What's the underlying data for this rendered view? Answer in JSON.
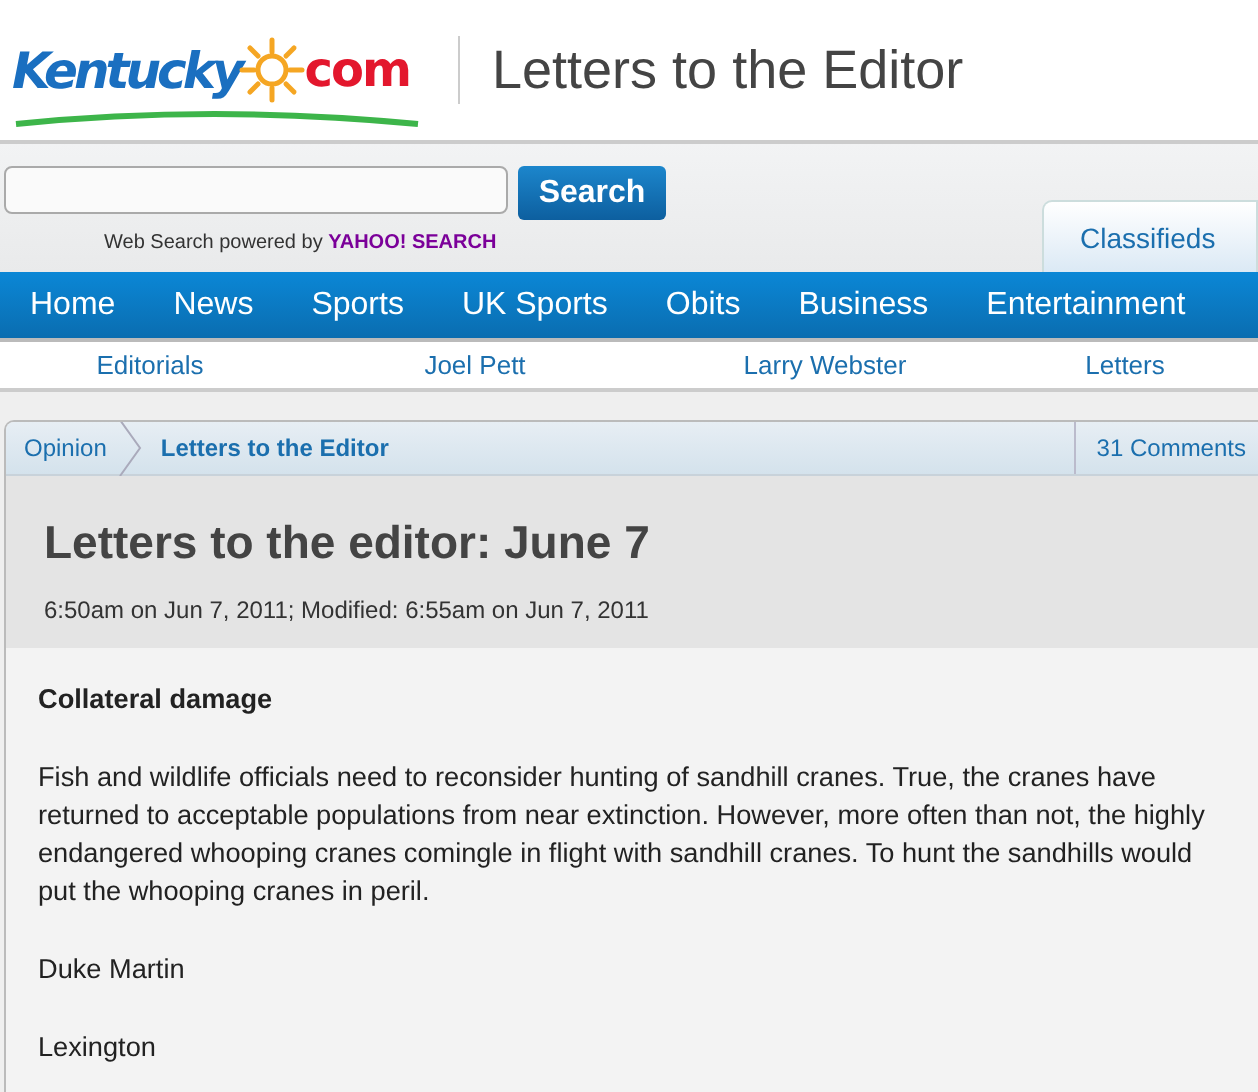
{
  "header": {
    "logo": {
      "word": "Kentucky",
      "suffix": "com"
    },
    "title": "Letters to the Editor"
  },
  "search": {
    "button": "Search",
    "powered_by": "Web Search powered by",
    "provider": "YAHOO! SEARCH"
  },
  "classifieds_tab": "Classifieds",
  "nav": [
    "Home",
    "News",
    "Sports",
    "UK Sports",
    "Obits",
    "Business",
    "Entertainment"
  ],
  "subnav": [
    "Editorials",
    "Joel Pett",
    "Larry Webster",
    "Letters"
  ],
  "breadcrumb": [
    {
      "label": "Opinion",
      "current": false
    },
    {
      "label": "Letters to the Editor",
      "current": true
    }
  ],
  "comments": "31 Comments",
  "article": {
    "title": "Letters to the editor: June 7",
    "dateline": "6:50am on Jun 7, 2011; Modified: 6:55am on Jun 7, 2011",
    "heading": "Collateral damage",
    "paragraphs": [
      "Fish and wildlife officials need to reconsider hunting of sandhill cranes. True, the cranes have returned to acceptable populations from near extinction. However, more often than not, the highly endangered whooping cranes comingle in flight with sandhill cranes. To hunt the sandhills would put the whooping cranes in peril.",
      "Duke Martin",
      "Lexington"
    ]
  }
}
